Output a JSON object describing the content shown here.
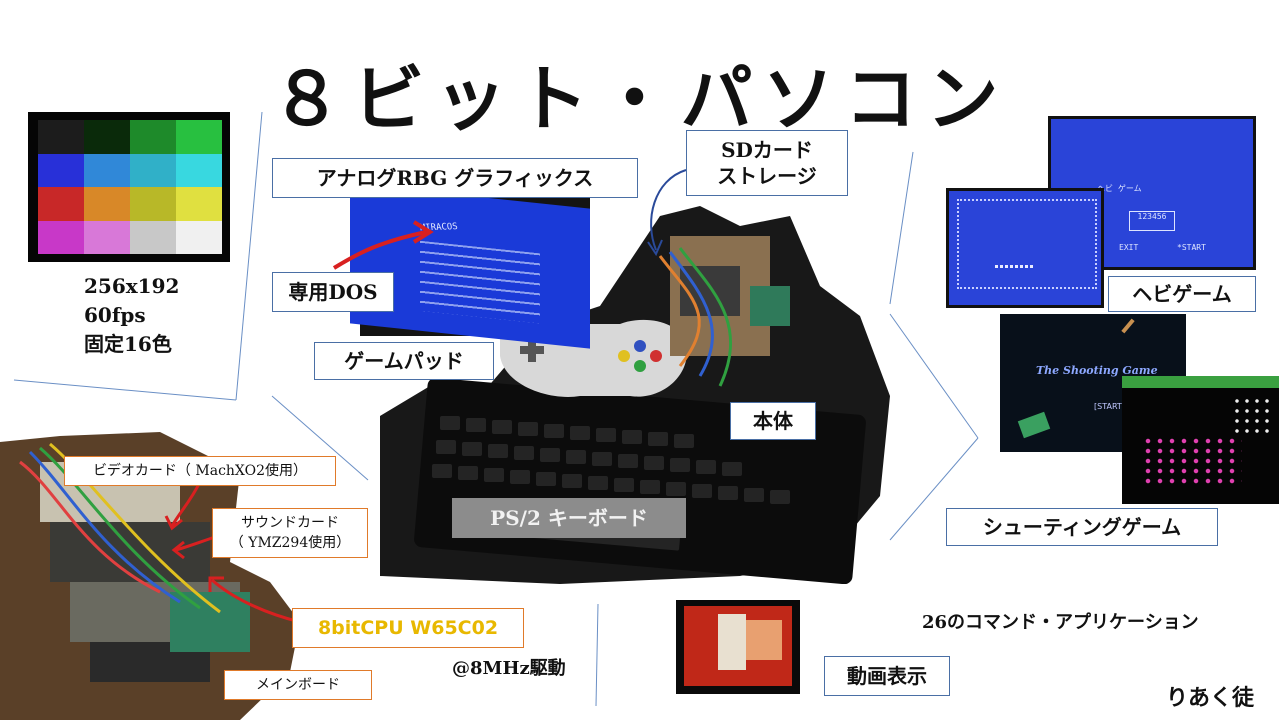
{
  "title": "８ビット・パソコン",
  "specs": {
    "resolution": "256x192",
    "framerate": "60fps",
    "colors": "固定16色"
  },
  "labels": {
    "graphics": "アナログRBG グラフィックス",
    "sd_storage_line1": "SDカード",
    "sd_storage_line2": "ストレージ",
    "dos": "専用DOS",
    "gamepad": "ゲームパッド",
    "main_unit": "本体",
    "keyboard": "PS/2 キーボード",
    "snake_game": "ヘビゲーム",
    "shooting_game": "シューティングゲーム",
    "video_card": "ビデオカード（ MachXO2使用）",
    "sound_card_line1": "サウンドカード",
    "sound_card_line2": "（ YMZ294使用）",
    "cpu": "8bitCPU W65C02",
    "clock": "@8MHz駆動",
    "main_board": "メインボード",
    "video_playback": "動画表示",
    "commands": "26のコマンド・アプリケーション",
    "author": "りあく徒"
  },
  "screens": {
    "dos_text": "MIRACOS",
    "snake_title": "ヘビ ゲーム",
    "snake_score": "123456",
    "snake_exit": "EXIT",
    "snake_start": "*START",
    "shooting_title": "The Shooting Game",
    "shooting_prompt": "[START] to play"
  },
  "palette": [
    [
      "#1c1c1c",
      "#0a2a0a",
      "#1e8a2a",
      "#28c040"
    ],
    [
      "#2830d8",
      "#3088d8",
      "#30b0c8",
      "#38d8e0"
    ],
    [
      "#c82828",
      "#d88828",
      "#b8b828",
      "#e0e040"
    ],
    [
      "#c838c8",
      "#d878d8",
      "#c8c8c8",
      "#f0f0f0"
    ]
  ],
  "colors": {
    "box_border": "#4a6fa5",
    "orange_border": "#e07a2a",
    "cpu_text": "#e8b800",
    "screen_blue": "#1a3ad8",
    "arrow_red": "#d82020"
  }
}
